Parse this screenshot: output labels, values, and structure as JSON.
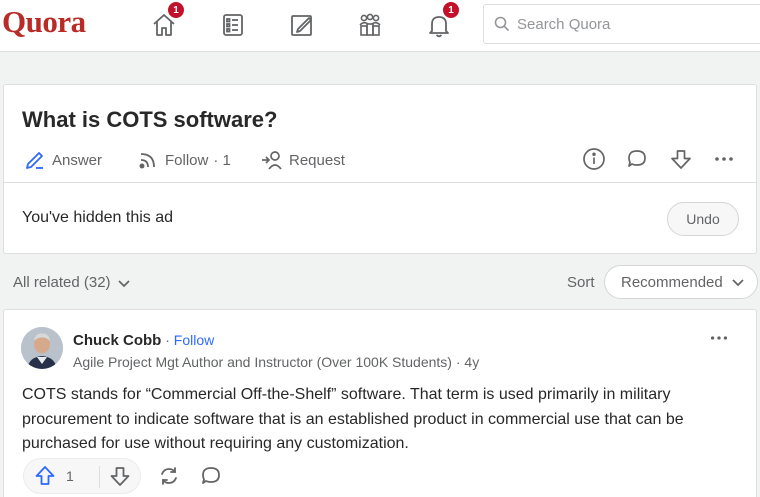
{
  "header": {
    "logo": "Quora",
    "nav": [
      {
        "name": "home-icon",
        "badge": "1"
      },
      {
        "name": "following-icon",
        "badge": ""
      },
      {
        "name": "answer-icon",
        "badge": ""
      },
      {
        "name": "spaces-icon",
        "badge": ""
      },
      {
        "name": "bell-icon",
        "badge": "1"
      }
    ],
    "search_placeholder": "Search Quora"
  },
  "question": {
    "title": "What is COTS software?",
    "answer_label": "Answer",
    "follow_label": "Follow",
    "follow_count": "· 1",
    "request_label": "Request",
    "hidden_ad_text": "You've hidden this ad",
    "undo_label": "Undo"
  },
  "related": {
    "label": "All related (32)",
    "sort_label": "Sort",
    "sort_value": "Recommended"
  },
  "answer": {
    "author": "Chuck Cobb",
    "separator": " · ",
    "follow_label": "Follow",
    "credential": "Agile Project Mgt Author and Instructor (Over 100K Students) · 4y",
    "text": "COTS stands for “Commercial Off-the-Shelf” software. That term is used primarily in military procurement to indicate software that is an established product in commercial use that can be purchased for use without requiring any customization.",
    "upvotes": "1"
  },
  "colors": {
    "brand": "#b92b27",
    "badge": "#c3112b",
    "link": "#2e69ff",
    "upvote": "#2e69ff"
  }
}
